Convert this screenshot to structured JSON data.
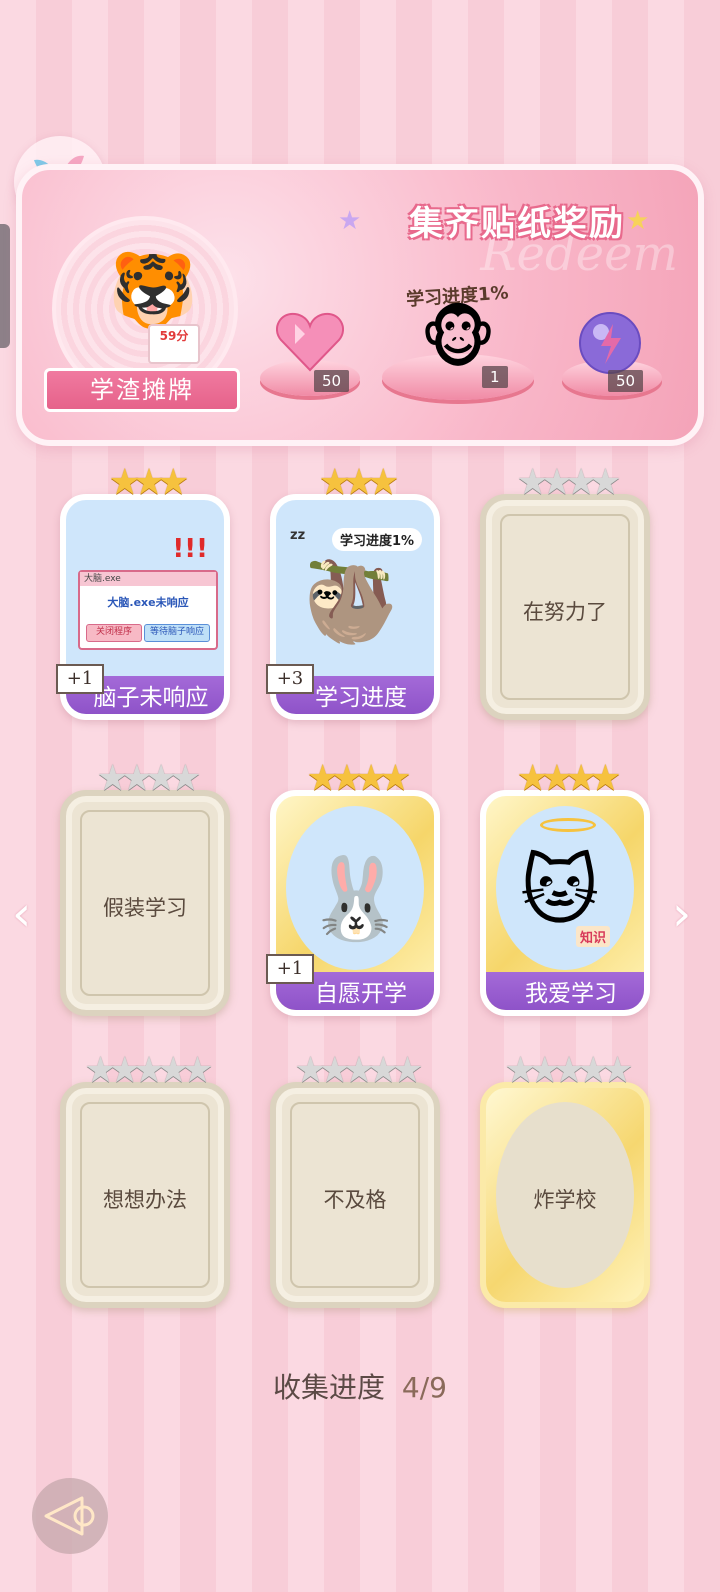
{
  "banner": {
    "title": "集齐贴纸奖励",
    "watermark": "Redeem",
    "avatar_label": "学渣摊牌",
    "tiger_paper_score": "59分",
    "progress_tag": "学习进度1%",
    "rewards": [
      {
        "icon": "heart-gem-icon",
        "count": "50"
      },
      {
        "icon": "monkey-sticker-icon",
        "count": "1"
      },
      {
        "icon": "lightning-orb-icon",
        "count": "50"
      }
    ]
  },
  "cards": [
    {
      "title": "脑子未响应",
      "stars": 3,
      "max_stars": 3,
      "unlocked": true,
      "plus": "+1",
      "art": {
        "window_title": "大脑.exe",
        "window_msg": "大脑.exe未响应",
        "btn_close": "关闭程序",
        "btn_wait": "等待脑子响应"
      }
    },
    {
      "title": "学习进度",
      "stars": 3,
      "max_stars": 3,
      "unlocked": true,
      "plus": "+3",
      "art": {
        "speech": "学习进度1%",
        "zz": "zz"
      }
    },
    {
      "title": "在努力了",
      "stars": 0,
      "max_stars": 4,
      "unlocked": false
    },
    {
      "title": "假装学习",
      "stars": 0,
      "max_stars": 4,
      "unlocked": false
    },
    {
      "title": "自愿开学",
      "stars": 4,
      "max_stars": 4,
      "unlocked": true,
      "plus": "+1"
    },
    {
      "title": "我爱学习",
      "stars": 4,
      "max_stars": 4,
      "unlocked": true,
      "art": {
        "book_label": "知识"
      }
    },
    {
      "title": "想想办法",
      "stars": 0,
      "max_stars": 5,
      "unlocked": false
    },
    {
      "title": "不及格",
      "stars": 0,
      "max_stars": 5,
      "unlocked": false
    },
    {
      "title": "炸学校",
      "stars": 0,
      "max_stars": 5,
      "unlocked": false,
      "gold_frame": true
    }
  ],
  "collection": {
    "label": "收集进度",
    "progress": "4/9",
    "collected": 4,
    "total": 9
  },
  "colors": {
    "accent": "#e6628a",
    "purple_banner": "#9a5fd0",
    "star_gold": "#f6c23e",
    "star_grey": "#d8d8d8"
  },
  "icons": {
    "logo": "pinwheel-logo-icon",
    "left": "chevron-left-icon",
    "right": "chevron-right-icon",
    "back": "back-arrow-icon"
  }
}
